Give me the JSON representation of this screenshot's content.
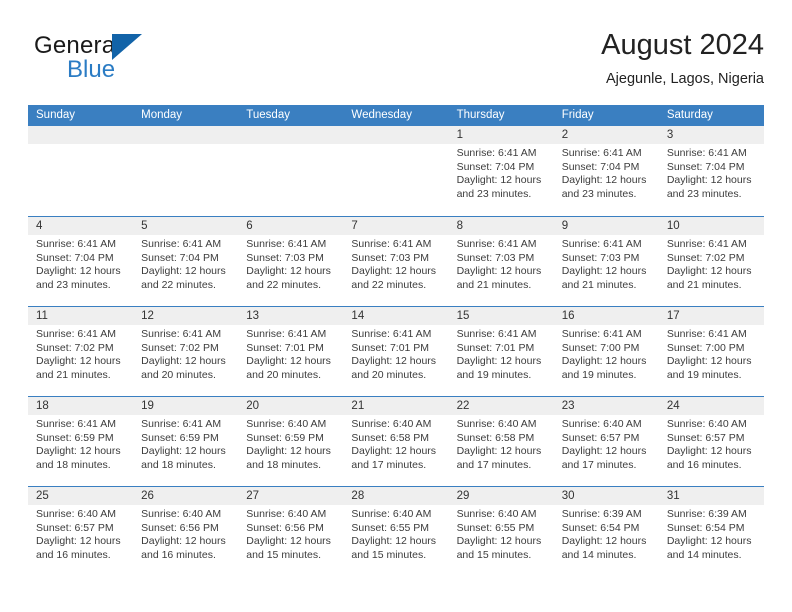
{
  "brand": {
    "name_part1": "General",
    "name_part2": "Blue",
    "logo_icon": "blue-triangle-icon"
  },
  "header": {
    "title": "August 2024",
    "subtitle": "Ajegunle, Lagos, Nigeria"
  },
  "colors": {
    "header_blue": "#3a7fc1",
    "brand_blue": "#2b7cc4",
    "logo_blue": "#1263a8",
    "cell_header_gray": "#efefef"
  },
  "calendar": {
    "day_headers": [
      "Sunday",
      "Monday",
      "Tuesday",
      "Wednesday",
      "Thursday",
      "Friday",
      "Saturday"
    ],
    "weeks": [
      [
        {
          "day": "",
          "empty": true,
          "sunrise": "",
          "sunset": "",
          "daylight_line1": "",
          "daylight_line2": ""
        },
        {
          "day": "",
          "empty": true,
          "sunrise": "",
          "sunset": "",
          "daylight_line1": "",
          "daylight_line2": ""
        },
        {
          "day": "",
          "empty": true,
          "sunrise": "",
          "sunset": "",
          "daylight_line1": "",
          "daylight_line2": ""
        },
        {
          "day": "",
          "empty": true,
          "sunrise": "",
          "sunset": "",
          "daylight_line1": "",
          "daylight_line2": ""
        },
        {
          "day": "1",
          "empty": false,
          "sunrise": "Sunrise: 6:41 AM",
          "sunset": "Sunset: 7:04 PM",
          "daylight_line1": "Daylight: 12 hours",
          "daylight_line2": "and 23 minutes."
        },
        {
          "day": "2",
          "empty": false,
          "sunrise": "Sunrise: 6:41 AM",
          "sunset": "Sunset: 7:04 PM",
          "daylight_line1": "Daylight: 12 hours",
          "daylight_line2": "and 23 minutes."
        },
        {
          "day": "3",
          "empty": false,
          "sunrise": "Sunrise: 6:41 AM",
          "sunset": "Sunset: 7:04 PM",
          "daylight_line1": "Daylight: 12 hours",
          "daylight_line2": "and 23 minutes."
        }
      ],
      [
        {
          "day": "4",
          "empty": false,
          "sunrise": "Sunrise: 6:41 AM",
          "sunset": "Sunset: 7:04 PM",
          "daylight_line1": "Daylight: 12 hours",
          "daylight_line2": "and 23 minutes."
        },
        {
          "day": "5",
          "empty": false,
          "sunrise": "Sunrise: 6:41 AM",
          "sunset": "Sunset: 7:04 PM",
          "daylight_line1": "Daylight: 12 hours",
          "daylight_line2": "and 22 minutes."
        },
        {
          "day": "6",
          "empty": false,
          "sunrise": "Sunrise: 6:41 AM",
          "sunset": "Sunset: 7:03 PM",
          "daylight_line1": "Daylight: 12 hours",
          "daylight_line2": "and 22 minutes."
        },
        {
          "day": "7",
          "empty": false,
          "sunrise": "Sunrise: 6:41 AM",
          "sunset": "Sunset: 7:03 PM",
          "daylight_line1": "Daylight: 12 hours",
          "daylight_line2": "and 22 minutes."
        },
        {
          "day": "8",
          "empty": false,
          "sunrise": "Sunrise: 6:41 AM",
          "sunset": "Sunset: 7:03 PM",
          "daylight_line1": "Daylight: 12 hours",
          "daylight_line2": "and 21 minutes."
        },
        {
          "day": "9",
          "empty": false,
          "sunrise": "Sunrise: 6:41 AM",
          "sunset": "Sunset: 7:03 PM",
          "daylight_line1": "Daylight: 12 hours",
          "daylight_line2": "and 21 minutes."
        },
        {
          "day": "10",
          "empty": false,
          "sunrise": "Sunrise: 6:41 AM",
          "sunset": "Sunset: 7:02 PM",
          "daylight_line1": "Daylight: 12 hours",
          "daylight_line2": "and 21 minutes."
        }
      ],
      [
        {
          "day": "11",
          "empty": false,
          "sunrise": "Sunrise: 6:41 AM",
          "sunset": "Sunset: 7:02 PM",
          "daylight_line1": "Daylight: 12 hours",
          "daylight_line2": "and 21 minutes."
        },
        {
          "day": "12",
          "empty": false,
          "sunrise": "Sunrise: 6:41 AM",
          "sunset": "Sunset: 7:02 PM",
          "daylight_line1": "Daylight: 12 hours",
          "daylight_line2": "and 20 minutes."
        },
        {
          "day": "13",
          "empty": false,
          "sunrise": "Sunrise: 6:41 AM",
          "sunset": "Sunset: 7:01 PM",
          "daylight_line1": "Daylight: 12 hours",
          "daylight_line2": "and 20 minutes."
        },
        {
          "day": "14",
          "empty": false,
          "sunrise": "Sunrise: 6:41 AM",
          "sunset": "Sunset: 7:01 PM",
          "daylight_line1": "Daylight: 12 hours",
          "daylight_line2": "and 20 minutes."
        },
        {
          "day": "15",
          "empty": false,
          "sunrise": "Sunrise: 6:41 AM",
          "sunset": "Sunset: 7:01 PM",
          "daylight_line1": "Daylight: 12 hours",
          "daylight_line2": "and 19 minutes."
        },
        {
          "day": "16",
          "empty": false,
          "sunrise": "Sunrise: 6:41 AM",
          "sunset": "Sunset: 7:00 PM",
          "daylight_line1": "Daylight: 12 hours",
          "daylight_line2": "and 19 minutes."
        },
        {
          "day": "17",
          "empty": false,
          "sunrise": "Sunrise: 6:41 AM",
          "sunset": "Sunset: 7:00 PM",
          "daylight_line1": "Daylight: 12 hours",
          "daylight_line2": "and 19 minutes."
        }
      ],
      [
        {
          "day": "18",
          "empty": false,
          "sunrise": "Sunrise: 6:41 AM",
          "sunset": "Sunset: 6:59 PM",
          "daylight_line1": "Daylight: 12 hours",
          "daylight_line2": "and 18 minutes."
        },
        {
          "day": "19",
          "empty": false,
          "sunrise": "Sunrise: 6:41 AM",
          "sunset": "Sunset: 6:59 PM",
          "daylight_line1": "Daylight: 12 hours",
          "daylight_line2": "and 18 minutes."
        },
        {
          "day": "20",
          "empty": false,
          "sunrise": "Sunrise: 6:40 AM",
          "sunset": "Sunset: 6:59 PM",
          "daylight_line1": "Daylight: 12 hours",
          "daylight_line2": "and 18 minutes."
        },
        {
          "day": "21",
          "empty": false,
          "sunrise": "Sunrise: 6:40 AM",
          "sunset": "Sunset: 6:58 PM",
          "daylight_line1": "Daylight: 12 hours",
          "daylight_line2": "and 17 minutes."
        },
        {
          "day": "22",
          "empty": false,
          "sunrise": "Sunrise: 6:40 AM",
          "sunset": "Sunset: 6:58 PM",
          "daylight_line1": "Daylight: 12 hours",
          "daylight_line2": "and 17 minutes."
        },
        {
          "day": "23",
          "empty": false,
          "sunrise": "Sunrise: 6:40 AM",
          "sunset": "Sunset: 6:57 PM",
          "daylight_line1": "Daylight: 12 hours",
          "daylight_line2": "and 17 minutes."
        },
        {
          "day": "24",
          "empty": false,
          "sunrise": "Sunrise: 6:40 AM",
          "sunset": "Sunset: 6:57 PM",
          "daylight_line1": "Daylight: 12 hours",
          "daylight_line2": "and 16 minutes."
        }
      ],
      [
        {
          "day": "25",
          "empty": false,
          "sunrise": "Sunrise: 6:40 AM",
          "sunset": "Sunset: 6:57 PM",
          "daylight_line1": "Daylight: 12 hours",
          "daylight_line2": "and 16 minutes."
        },
        {
          "day": "26",
          "empty": false,
          "sunrise": "Sunrise: 6:40 AM",
          "sunset": "Sunset: 6:56 PM",
          "daylight_line1": "Daylight: 12 hours",
          "daylight_line2": "and 16 minutes."
        },
        {
          "day": "27",
          "empty": false,
          "sunrise": "Sunrise: 6:40 AM",
          "sunset": "Sunset: 6:56 PM",
          "daylight_line1": "Daylight: 12 hours",
          "daylight_line2": "and 15 minutes."
        },
        {
          "day": "28",
          "empty": false,
          "sunrise": "Sunrise: 6:40 AM",
          "sunset": "Sunset: 6:55 PM",
          "daylight_line1": "Daylight: 12 hours",
          "daylight_line2": "and 15 minutes."
        },
        {
          "day": "29",
          "empty": false,
          "sunrise": "Sunrise: 6:40 AM",
          "sunset": "Sunset: 6:55 PM",
          "daylight_line1": "Daylight: 12 hours",
          "daylight_line2": "and 15 minutes."
        },
        {
          "day": "30",
          "empty": false,
          "sunrise": "Sunrise: 6:39 AM",
          "sunset": "Sunset: 6:54 PM",
          "daylight_line1": "Daylight: 12 hours",
          "daylight_line2": "and 14 minutes."
        },
        {
          "day": "31",
          "empty": false,
          "sunrise": "Sunrise: 6:39 AM",
          "sunset": "Sunset: 6:54 PM",
          "daylight_line1": "Daylight: 12 hours",
          "daylight_line2": "and 14 minutes."
        }
      ]
    ]
  }
}
